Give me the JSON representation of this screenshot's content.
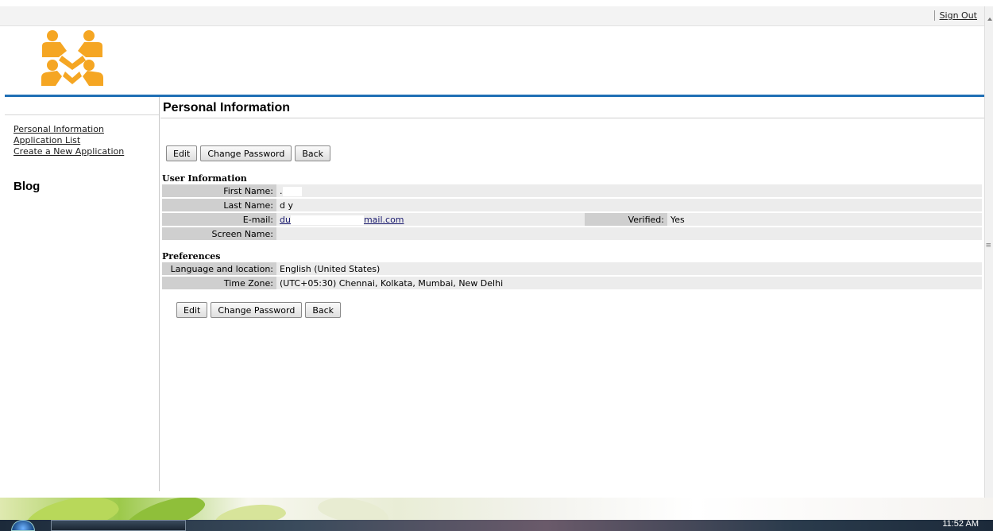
{
  "header": {
    "sign_out": "Sign Out"
  },
  "nav": {
    "items": [
      {
        "label": "Personal Information"
      },
      {
        "label": "Application List"
      },
      {
        "label": "Create a New Application"
      }
    ],
    "blog": "Blog"
  },
  "main": {
    "title": "Personal Information",
    "buttons": {
      "edit": "Edit",
      "change_password": "Change Password",
      "back": "Back"
    },
    "user_info": {
      "heading": "User Information",
      "first_name_label": "First Name:",
      "first_name_value": ".",
      "last_name_label": "Last Name:",
      "last_name_value": "d    y",
      "email_label": "E-mail:",
      "email_value_start": "du",
      "email_value_end": "mail.com",
      "verified_label": "Verified:",
      "verified_value": "Yes",
      "screen_name_label": "Screen Name:",
      "screen_name_value": ""
    },
    "preferences": {
      "heading": "Preferences",
      "language_label": "Language and location:",
      "language_value": "English (United States)",
      "timezone_label": "Time Zone:",
      "timezone_value": "(UTC+05:30) Chennai, Kolkata, Mumbai, New Delhi"
    }
  },
  "taskbar": {
    "clock": "11:52 AM"
  },
  "colors": {
    "accent_blue": "#1f6fb5",
    "logo_orange": "#f5a623"
  },
  "icons": {
    "logo": "people-logo-icon",
    "start": "windows-start-icon"
  }
}
